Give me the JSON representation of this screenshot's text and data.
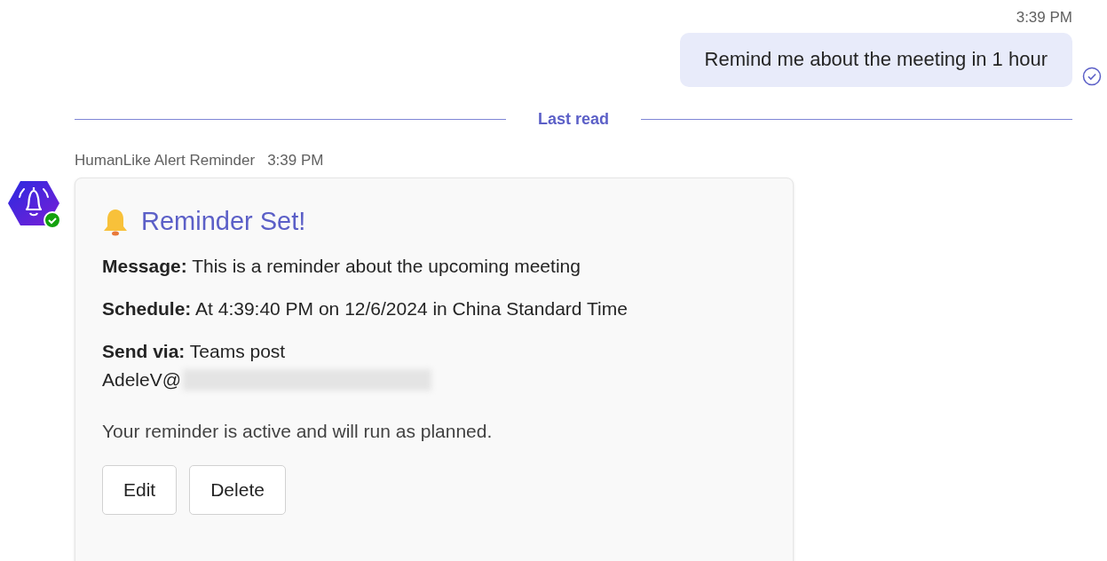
{
  "outgoing": {
    "time": "3:39 PM",
    "text": "Remind me about the meeting in 1 hour",
    "read": true
  },
  "divider": {
    "label": "Last read"
  },
  "incoming": {
    "sender": "HumanLike Alert Reminder",
    "time": "3:39 PM",
    "online": true,
    "card": {
      "title": "Reminder Set!",
      "fields": [
        {
          "label": "Message:",
          "value": "This is a reminder about the upcoming meeting"
        },
        {
          "label": "Schedule:",
          "value": "At 4:39:40 PM on 12/6/2024 in China Standard Time"
        },
        {
          "label": "Send via:",
          "value": "Teams post"
        }
      ],
      "recipient": "AdeleV@",
      "recipient_redacted": true,
      "status_text": "Your reminder is active and will run as planned.",
      "buttons": [
        "Edit",
        "Delete"
      ]
    }
  }
}
